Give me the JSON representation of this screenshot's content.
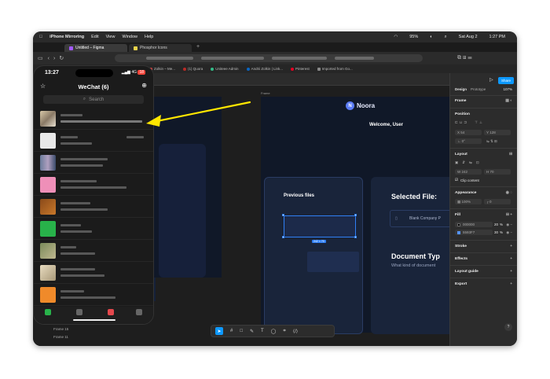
{
  "menubar": {
    "app": "iPhone Mirroring",
    "items": [
      "Edit",
      "View",
      "Window",
      "Help"
    ],
    "battery": "95%",
    "date": "Sat Aug 2",
    "time": "1:27 PM"
  },
  "browser": {
    "tabs": [
      {
        "label": "Untitled – Figma",
        "active": true
      },
      {
        "label": "Phosphor Icons",
        "active": false
      }
    ],
    "bookmarks": [
      "Zolkin – Me...",
      "(1) Quora",
      "Uniteee Admin",
      "Andrii Zolkin | Link...",
      "Pinterest",
      "Imported from Go..."
    ]
  },
  "figma": {
    "share_label": "Share",
    "panel_tabs": [
      "Design",
      "Prototype"
    ],
    "zoom": "107%",
    "frame_label": "Frame",
    "position_label": "Position",
    "x_value": "54",
    "y_value": "128",
    "rotation_value": "0°",
    "layout_label": "Layout",
    "width_value": "242",
    "height_value": "70",
    "clip_label": "Clip content",
    "appearance_label": "Appearance",
    "opacity_value": "100%",
    "radius_value": "0",
    "fill_label": "Fill",
    "fills": [
      {
        "hex": "000000",
        "opacity": "20",
        "unit": "%",
        "color": "#000000"
      },
      {
        "hex": "5593F7",
        "opacity": "30",
        "unit": "%",
        "color": "#5593F7"
      }
    ],
    "stroke_label": "Stroke",
    "effects_label": "Effects",
    "layout_guide_label": "Layout guide",
    "export_label": "Export",
    "help": "?"
  },
  "canvas": {
    "frame_name": "Frame",
    "brand": "Noora",
    "brand_initial": "N",
    "welcome": "Welcome, User",
    "previous_files": "Previous files",
    "selection_size": "242 × 70",
    "selected_file": "Selected File:",
    "blank_company": "Blank Company P",
    "document_type": "Document Typ",
    "document_type_sub": "What kind of document"
  },
  "layers": [
    "Frame 15",
    "Frame 11"
  ],
  "phone": {
    "time": "13:27",
    "network": "4G",
    "battery": "18",
    "title": "WeChat (6)",
    "search_placeholder": "Search"
  },
  "colors": {
    "accent": "#0d99ff",
    "arrow": "#ffe600",
    "noora": "#5b7cf5"
  }
}
